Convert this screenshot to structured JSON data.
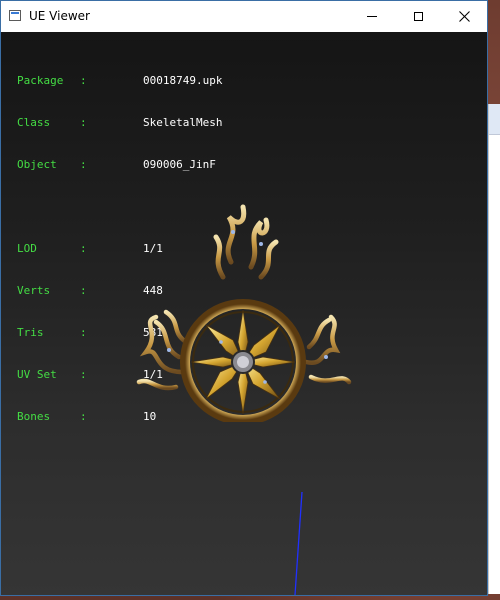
{
  "window": {
    "title": "UE Viewer"
  },
  "info": {
    "package": {
      "label": "Package",
      "value": "00018749.upk"
    },
    "class": {
      "label": "Class  ",
      "value": "SkeletalMesh"
    },
    "object": {
      "label": "Object ",
      "value": "090006_JinF"
    },
    "lod": {
      "label": "LOD    ",
      "value": "1/1"
    },
    "verts": {
      "label": "Verts  ",
      "value": "448"
    },
    "tris": {
      "label": "Tris   ",
      "value": "581"
    },
    "uvset": {
      "label": "UV Set ",
      "value": "1/1"
    },
    "bones": {
      "label": "Bones  ",
      "value": "10"
    }
  },
  "colors": {
    "label_green": "#44dd44",
    "value_white": "#ffffff",
    "axis_blue": "#2030ff",
    "gold": "#d4a530"
  },
  "icons": {
    "app": "app-window-icon",
    "minimize": "minimize-icon",
    "maximize": "maximize-icon",
    "close": "close-icon"
  }
}
